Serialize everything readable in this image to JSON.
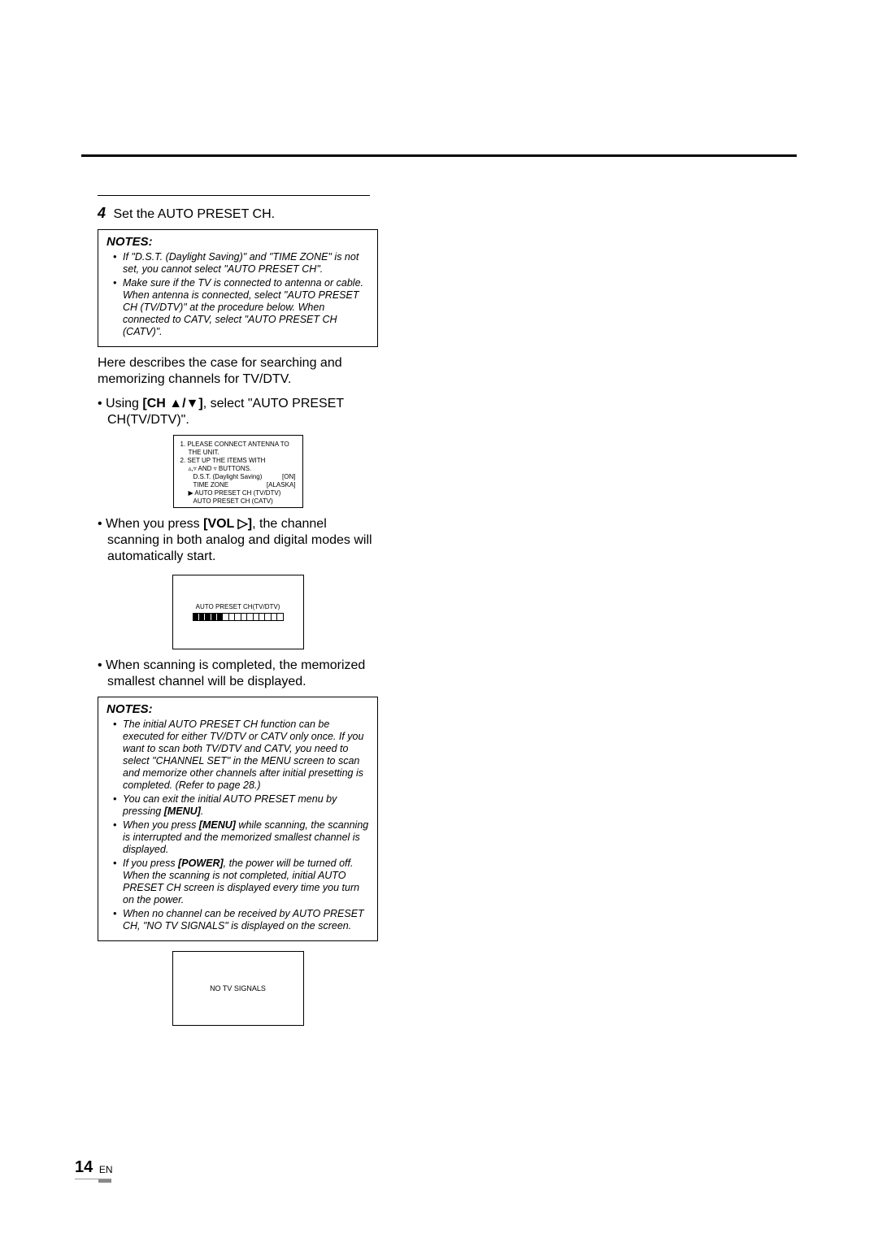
{
  "step": {
    "num": "4",
    "text": "Set the AUTO PRESET CH."
  },
  "notes1": {
    "title": "NOTES:",
    "items": [
      "If \"D.S.T. (Daylight Saving)\" and \"TIME ZONE\" is not set, you cannot select \"AUTO PRESET CH\".",
      "Make sure if the TV is connected to antenna or cable. When antenna is connected, select \"AUTO PRESET CH (TV/DTV)\" at the procedure below.  When connected to CATV, select \"AUTO PRESET CH (CATV)\"."
    ]
  },
  "para1": "Here describes the case for searching and memorizing channels for TV/DTV.",
  "bullet1": {
    "prefix": "Using ",
    "bold": "[CH ▲/▼]",
    "suffix": ", select \"AUTO PRESET CH(TV/DTV)\"."
  },
  "osd1": {
    "l1a": "1. PLEASE CONNECT ANTENNA TO",
    "l1b": "THE UNIT.",
    "l2a": "2. SET UP THE ITEMS WITH",
    "l2b_left": "▵,▿ AND ▿ BUTTONS.",
    "row1_l": "D.S.T. (Daylight Saving)",
    "row1_r": "[ON]",
    "row2_l": "TIME ZONE",
    "row2_r": "[ALASKA]",
    "row3": "▶ AUTO PRESET CH (TV/DTV)",
    "row4": "AUTO PRESET CH (CATV)"
  },
  "bullet2": {
    "prefix": "When you press ",
    "bold": "[VOL ▷]",
    "suffix": ", the channel scanning in both analog and digital modes will automatically start."
  },
  "osd2": {
    "title": "AUTO PRESET CH(TV/DTV)"
  },
  "bullet3": "When scanning is completed, the memorized smallest channel will be displayed.",
  "notes2": {
    "title": "NOTES:",
    "items": [
      {
        "text": "The initial AUTO PRESET CH function can be executed for either TV/DTV or CATV only once. If you want to scan both TV/DTV and CATV, you need to select \"CHANNEL SET\" in the MENU screen to scan and memorize other channels after initial presetting is completed. (Refer to page 28.)"
      },
      {
        "text_pre": "You can exit the initial AUTO PRESET menu by pressing ",
        "bold": "[MENU]",
        "text_post": "."
      },
      {
        "text_pre": "When you press ",
        "bold": "[MENU]",
        "text_post": " while scanning, the scanning is interrupted and the memorized smallest channel is displayed."
      },
      {
        "text_pre": "If you press ",
        "bold": "[POWER]",
        "text_post": ", the power will be turned off. When the scanning is not completed, initial AUTO PRESET CH screen is displayed every time you turn on the power."
      },
      {
        "text": "When no channel can be received by AUTO PRESET CH, \"NO TV SIGNALS\" is displayed on the screen."
      }
    ]
  },
  "osd3": {
    "text": "NO TV SIGNALS"
  },
  "footer": {
    "page": "14",
    "lang": "EN"
  }
}
